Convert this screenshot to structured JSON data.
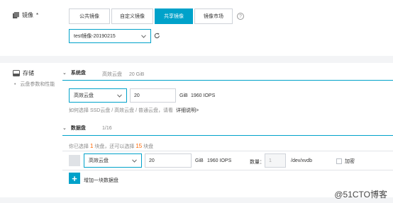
{
  "image_section": {
    "label": "镜像",
    "required_mark": "*",
    "icon": "image-stack-icon",
    "tabs": [
      {
        "label": "公共镜像",
        "active": false
      },
      {
        "label": "自定义镜像",
        "active": false
      },
      {
        "label": "共享镜像",
        "active": true
      },
      {
        "label": "镜像市场",
        "active": false
      }
    ],
    "help_glyph": "?",
    "selected_image": "test镜像-20190215",
    "refresh_icon": "refresh-icon"
  },
  "storage_section": {
    "label": "存储",
    "icon": "disk-icon",
    "bullet": "•",
    "side_link": "云盘参数和性能",
    "system_disk": {
      "toggle": "⌄",
      "title": "系统盘",
      "summary_type": "高效云盘",
      "summary_size": "20 GiB",
      "type_value": "高效云盘",
      "size_value": "20",
      "unit": "GiB",
      "iops": "1960 IOPS",
      "hint": "如何选择 SSD云盘 / 高效云盘 / 普通云盘，请看",
      "hint_link": "详细说明>"
    },
    "data_disk": {
      "toggle": "⌄",
      "title": "数据盘",
      "count": "1/16",
      "selected_prefix": "你已选择",
      "selected_count": "1",
      "selected_mid": "块盘，还可以选择",
      "remaining_count": "15",
      "selected_suffix": "块盘",
      "type_value": "高效云盘",
      "size_value": "20",
      "unit": "GiB",
      "iops": "1960 IOPS",
      "qty_label": "数量：",
      "qty_value": "1",
      "device": "/dev/xvdb",
      "checkbox_label": "加密",
      "add_label": "增加一块数据盘",
      "add_glyph": "+"
    }
  },
  "watermark": "@51CTO博客",
  "colors": {
    "accent": "#00a2ca",
    "orange": "#ff6600",
    "background": "#f3f4f6"
  }
}
